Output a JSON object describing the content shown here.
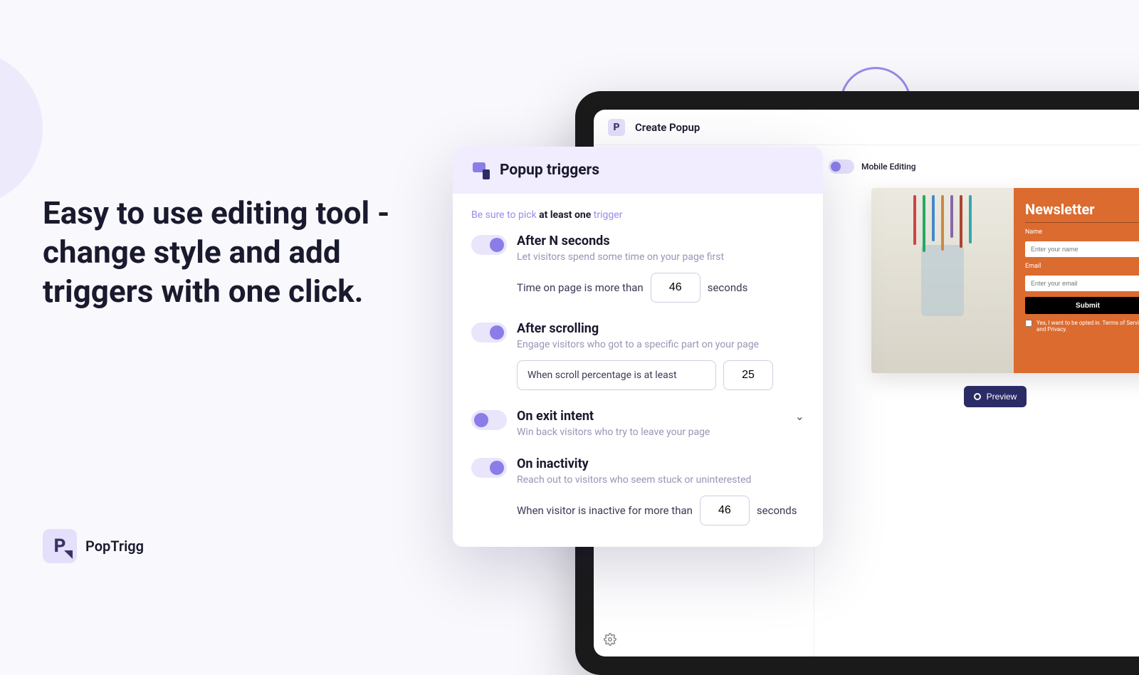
{
  "headline": "Easy to use editing tool - change style and add triggers with one click.",
  "brand": {
    "logo_letter": "P",
    "name": "PopTrigg"
  },
  "appbar": {
    "title": "Create Popup",
    "logo_letter": "P"
  },
  "mobile_editing": {
    "label": "Mobile Editing"
  },
  "preview": {
    "newsletter_title": "Newsletter",
    "name_label": "Name",
    "name_placeholder": "Enter your name",
    "email_label": "Email",
    "email_placeholder": "Enter your email",
    "submit": "Submit",
    "consent": "Yes, I want to be opted in. Terms of Service and Privacy.",
    "button": "Preview"
  },
  "triggers": {
    "title": "Popup triggers",
    "hint_prefix": "Be sure to pick ",
    "hint_bold": "at least one",
    "hint_suffix": " trigger",
    "after_seconds": {
      "title": "After N seconds",
      "desc": "Let visitors spend some time on your page first",
      "label_before": "Time on page is more than",
      "value": "46",
      "label_after": "seconds"
    },
    "after_scrolling": {
      "title": "After scrolling",
      "desc": "Engage visitors who got to a specific part on your page",
      "select": "When scroll percentage is at least",
      "value": "25"
    },
    "exit_intent": {
      "title": "On exit intent",
      "desc": "Win back visitors who try to leave your page"
    },
    "inactivity": {
      "title": "On inactivity",
      "desc": "Reach out to visitors who seem stuck or uninterested",
      "label_before": "When visitor is inactive for more than",
      "value": "46",
      "label_after": "seconds"
    }
  },
  "bg_left": {
    "line1_text": "page",
    "line1_val": "",
    "line2_text": "uninterested",
    "line3_before": "When visitor is inactive for more than",
    "line3_val": "46",
    "line3_after": "seconds"
  }
}
